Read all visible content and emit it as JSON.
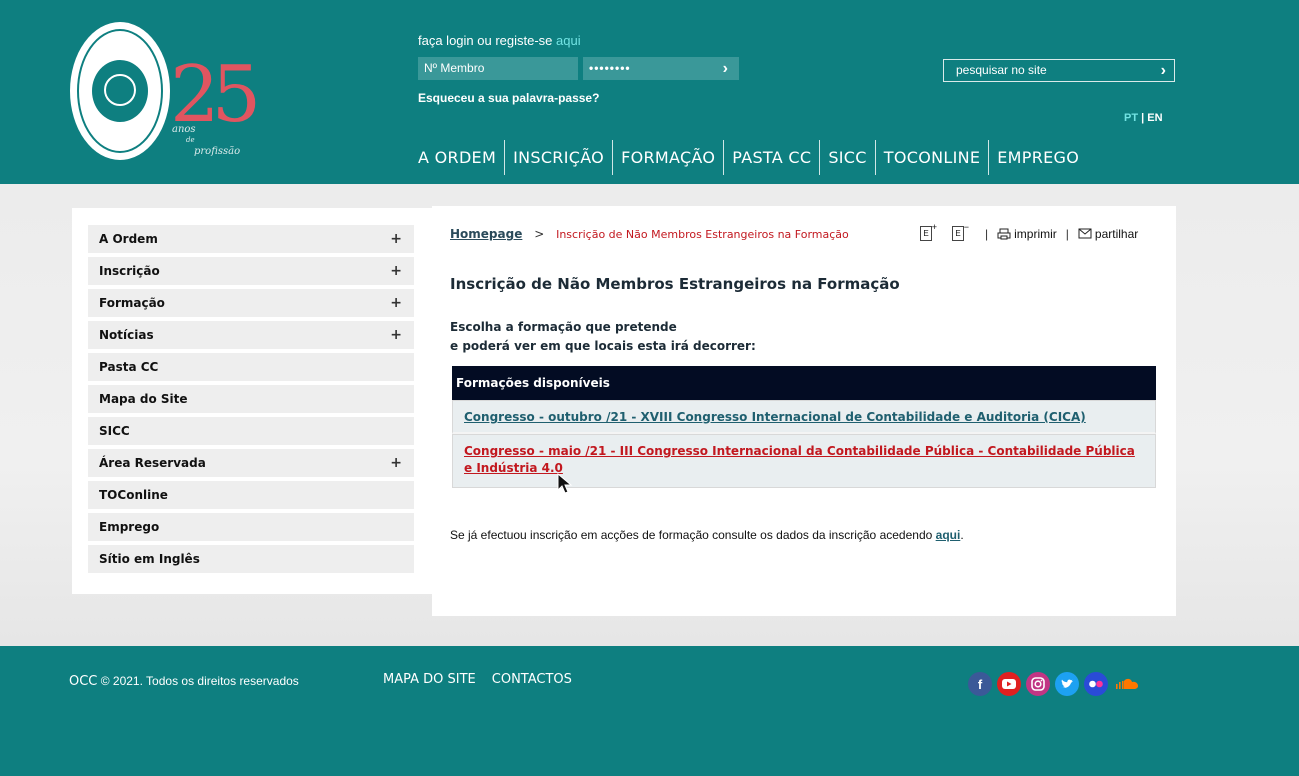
{
  "header": {
    "logo": {
      "number": "25",
      "line1": "anos",
      "line2": "de",
      "line3": "profissão"
    },
    "login": {
      "text": "faça login ou registe-se",
      "link": "aqui"
    },
    "member_field": "Nº Membro",
    "password_field": "••••••••",
    "go_arrow": "›",
    "forgot": "Esqueceu a sua palavra-passe?",
    "search_placeholder": "pesquisar no site",
    "lang": {
      "pt": "PT",
      "sep": "|",
      "en": "EN"
    },
    "nav": [
      "A ORDEM",
      "INSCRIÇÃO",
      "FORMAÇÃO",
      "PASTA CC",
      "SICC",
      "TOCONLINE",
      "EMPREGO"
    ]
  },
  "sidebar": {
    "items": [
      {
        "label": "A Ordem",
        "plus": "+"
      },
      {
        "label": "Inscrição",
        "plus": "+"
      },
      {
        "label": "Formação",
        "plus": "+"
      },
      {
        "label": "Notícias",
        "plus": "+"
      },
      {
        "label": "Pasta CC",
        "plus": ""
      },
      {
        "label": "Mapa do Site",
        "plus": ""
      },
      {
        "label": "SICC",
        "plus": ""
      },
      {
        "label": "Área Reservada",
        "plus": "+"
      },
      {
        "label": "TOConline",
        "plus": ""
      },
      {
        "label": "Emprego",
        "plus": ""
      },
      {
        "label": "Sítio em Inglês",
        "plus": ""
      }
    ]
  },
  "breadcrumb": {
    "home": "Homepage",
    "sep": ">",
    "current": "Inscrição de Não Membros Estrangeiros na Formação"
  },
  "tools": {
    "font_up": "E",
    "font_down": "E",
    "print": "imprimir",
    "share": "partilhar",
    "sep": "|"
  },
  "main": {
    "title": "Inscrição de Não Membros Estrangeiros na Formação",
    "intro_line1": "Escolha a formação que pretende",
    "intro_line2": "e poderá ver em que locais esta irá decorrer:",
    "table_header": "Formações disponíveis",
    "rows": [
      "Congresso - outubro /21 - XVIII Congresso Internacional de Contabilidade e Auditoria (CICA)",
      "Congresso - maio /21 - III Congresso Internacional da Contabilidade Pública - Contabilidade Pública e Indústria 4.0"
    ],
    "note_text": "Se já efectuou inscrição em acções de formação consulte os dados da inscrição acedendo",
    "note_link": "aqui",
    "note_end": "."
  },
  "footer": {
    "occ": "OCC",
    "copyright": "© 2021. Todos os direitos reservados",
    "nav": [
      "MAPA DO SITE",
      "CONTACTOS"
    ],
    "social": [
      "facebook-icon",
      "youtube-icon",
      "instagram-icon",
      "twitter-icon",
      "flickr-icon",
      "soundcloud-icon"
    ]
  },
  "colors": {
    "brand": "#0e7f80",
    "accent": "#72e3e3",
    "link_red": "#c2181f",
    "table_header": "#030c23"
  }
}
